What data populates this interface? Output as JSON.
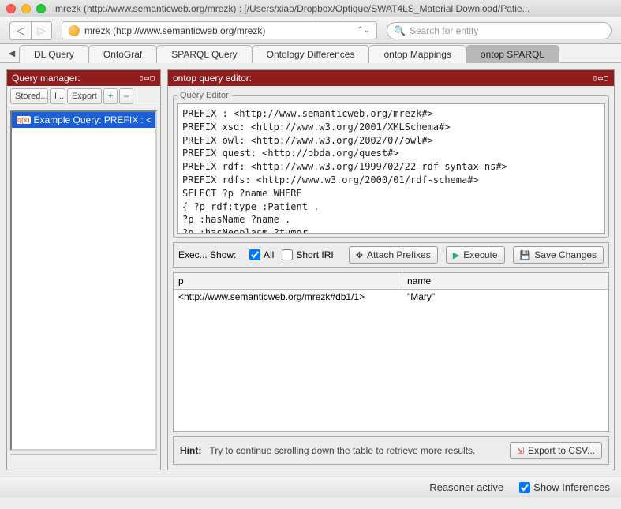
{
  "window": {
    "title": "mrezk (http://www.semanticweb.org/mrezk)  : [/Users/xiao/Dropbox/Optique/SWAT4LS_Material Download/Patie..."
  },
  "toolbar": {
    "uri_label": "mrezk (http://www.semanticweb.org/mrezk)",
    "search_placeholder": "Search for entity"
  },
  "tabs": {
    "items": [
      {
        "label": "DL Query"
      },
      {
        "label": "OntoGraf"
      },
      {
        "label": "SPARQL Query"
      },
      {
        "label": "Ontology Differences"
      },
      {
        "label": "ontop Mappings"
      },
      {
        "label": "ontop SPARQL"
      }
    ],
    "active_index": 5
  },
  "query_manager": {
    "title": "Query manager:",
    "buttons": {
      "stored": "Stored...",
      "import": "I...",
      "export": "Export",
      "add": "+",
      "remove": "–"
    },
    "items": [
      {
        "label": "Example Query: PREFIX : <"
      }
    ]
  },
  "query_editor": {
    "title": "ontop query editor:",
    "legend": "Query Editor",
    "query_text": "PREFIX : <http://www.semanticweb.org/mrezk#>\nPREFIX xsd: <http://www.w3.org/2001/XMLSchema#>\nPREFIX owl: <http://www.w3.org/2002/07/owl#>\nPREFIX quest: <http://obda.org/quest#>\nPREFIX rdf: <http://www.w3.org/1999/02/22-rdf-syntax-ns#>\nPREFIX rdfs: <http://www.w3.org/2000/01/rdf-schema#>\nSELECT ?p ?name WHERE\n{ ?p rdf:type :Patient .\n?p :hasName ?name .\n?p :hasNeoplasm ?tumor .\n?tumor :hasStage :stage-IIIa .}",
    "exec_bar": {
      "label": "Exec...  Show:",
      "all_label": "All",
      "short_iri_label": "Short IRI",
      "attach_label": "Attach Prefixes",
      "execute_label": "Execute",
      "save_label": "Save Changes",
      "all_checked": true,
      "short_iri_checked": false
    },
    "results": {
      "columns": [
        "p",
        "name"
      ],
      "rows": [
        {
          "p": "<http://www.semanticweb.org/mrezk#db1/1>",
          "name": "\"Mary\""
        }
      ]
    },
    "hint": {
      "label": "Hint:",
      "text": "Try to continue scrolling down the table to retrieve more results.",
      "export_label": "Export to CSV..."
    }
  },
  "status": {
    "reasoner": "Reasoner active",
    "show_inferences_label": "Show Inferences",
    "show_inferences_checked": true
  }
}
